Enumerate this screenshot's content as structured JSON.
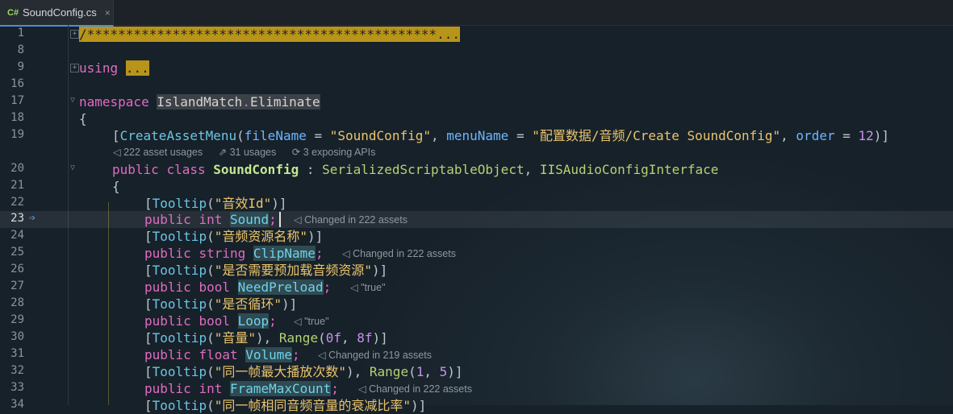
{
  "tab": {
    "icon": "C#",
    "label": "SoundConfig.cs",
    "close": "×"
  },
  "lines": {
    "l1": {
      "num": "1",
      "text": "/*********************************************..."
    },
    "l8": {
      "num": "8"
    },
    "l9": {
      "num": "9",
      "kw": "using",
      "dots": "..."
    },
    "l16": {
      "num": "16"
    },
    "l17": {
      "num": "17",
      "kw": "namespace",
      "ns1": "IslandMatch",
      "dot": ".",
      "ns2": "Eliminate"
    },
    "l18": {
      "num": "18",
      "text": "{"
    },
    "l19": {
      "num": "19",
      "p1": "[",
      "attr": "CreateAssetMenu",
      "p2": "(",
      "a1": "fileName",
      "p3": " = ",
      "s1": "\"SoundConfig\"",
      "p4": ", ",
      "a2": "menuName",
      "p5": " = ",
      "s2": "\"配置数据/音频/Create SoundConfig\"",
      "p6": ", ",
      "a3": "order",
      "p7": " = ",
      "n1": "12",
      "p8": ")]"
    },
    "meta19": {
      "usages1": "222 asset usages",
      "usages2": "31 usages",
      "usages3": "3 exposing APIs"
    },
    "l20": {
      "num": "20",
      "k1": "public",
      "k2": "class",
      "name": "SoundConfig",
      "p1": " : ",
      "base1": "SerializedScriptableObject",
      "p2": ", ",
      "base2": "IISAudioConfigInterface"
    },
    "l21": {
      "num": "21",
      "text": "{"
    },
    "l22": {
      "num": "22",
      "p1": "[",
      "attr": "Tooltip",
      "p2": "(",
      "s": "\"音效Id\"",
      "p3": ")]"
    },
    "l23": {
      "num": "23",
      "k1": "public",
      "k2": "int",
      "field": "Sound",
      "p": ";",
      "hint": "Changed in 222 assets"
    },
    "l24": {
      "num": "24",
      "p1": "[",
      "attr": "Tooltip",
      "p2": "(",
      "s": "\"音频资源名称\"",
      "p3": ")]"
    },
    "l25": {
      "num": "25",
      "k1": "public",
      "k2": "string",
      "field": "ClipName",
      "p": ";",
      "hint": "Changed in 222 assets"
    },
    "l26": {
      "num": "26",
      "p1": "[",
      "attr": "Tooltip",
      "p2": "(",
      "s": "\"是否需要预加载音频资源\"",
      "p3": ")]"
    },
    "l27": {
      "num": "27",
      "k1": "public",
      "k2": "bool",
      "field": "NeedPreload",
      "p": ";",
      "hint": "\"true\""
    },
    "l28": {
      "num": "28",
      "p1": "[",
      "attr": "Tooltip",
      "p2": "(",
      "s": "\"是否循环\"",
      "p3": ")]"
    },
    "l29": {
      "num": "29",
      "k1": "public",
      "k2": "bool",
      "field": "Loop",
      "p": ";",
      "hint": "\"true\""
    },
    "l30": {
      "num": "30",
      "p1": "[",
      "attr": "Tooltip",
      "p2": "(",
      "s": "\"音量\"",
      "p3": "), ",
      "attr2": "Range",
      "p4": "(",
      "n1": "0f",
      "p5": ", ",
      "n2": "8f",
      "p6": ")]"
    },
    "l31": {
      "num": "31",
      "k1": "public",
      "k2": "float",
      "field": "Volume",
      "p": ";",
      "hint": "Changed in 219 assets"
    },
    "l32": {
      "num": "32",
      "p1": "[",
      "attr": "Tooltip",
      "p2": "(",
      "s": "\"同一帧最大播放次数\"",
      "p3": "), ",
      "attr2": "Range",
      "p4": "(",
      "n1": "1",
      "p5": ", ",
      "n2": "5",
      "p6": ")]"
    },
    "l33": {
      "num": "33",
      "k1": "public",
      "k2": "int",
      "field": "FrameMaxCount",
      "p": ";",
      "hint": "Changed in 222 assets"
    },
    "l34": {
      "num": "34",
      "p1": "[",
      "attr": "Tooltip",
      "p2": "(",
      "s": "\"同一帧相同音频音量的衰减比率\"",
      "p3": ")]"
    }
  }
}
